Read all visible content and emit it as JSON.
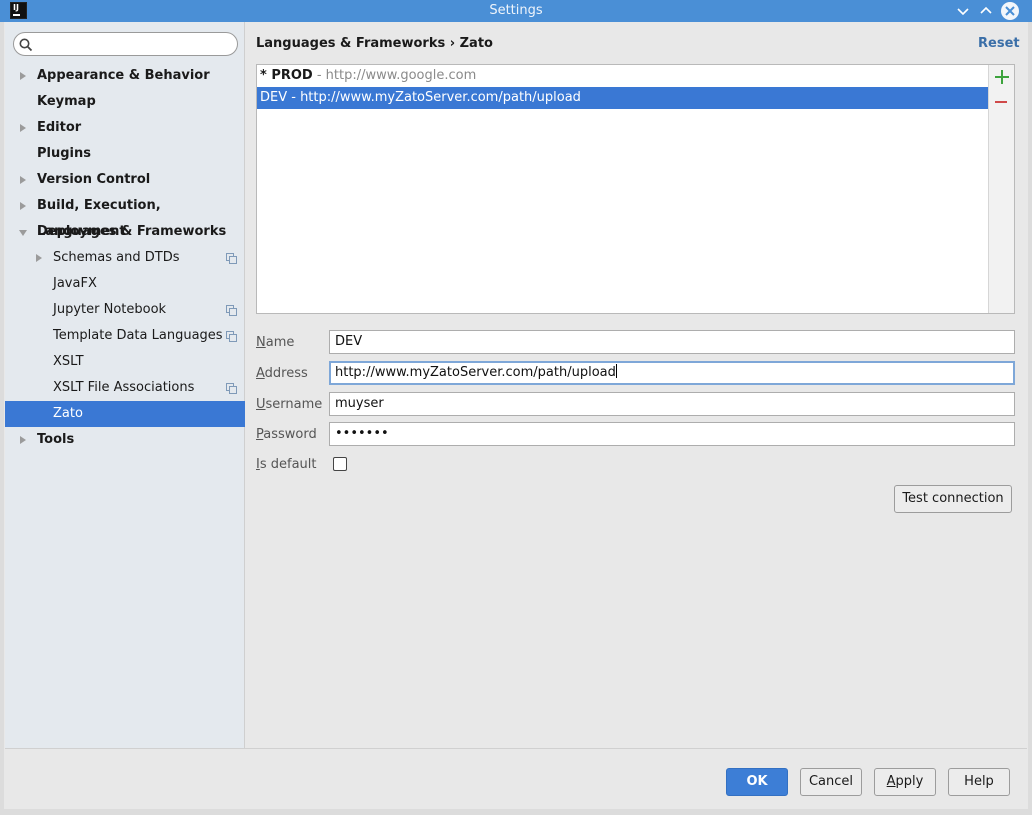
{
  "window": {
    "title": "Settings"
  },
  "search": {
    "placeholder": ""
  },
  "sidebar": {
    "items": [
      {
        "label": "Appearance & Behavior"
      },
      {
        "label": "Keymap"
      },
      {
        "label": "Editor"
      },
      {
        "label": "Plugins"
      },
      {
        "label": "Version Control"
      },
      {
        "label": "Build, Execution, Deployment"
      },
      {
        "label": "Languages & Frameworks"
      },
      {
        "label": "Schemas and DTDs"
      },
      {
        "label": "JavaFX"
      },
      {
        "label": "Jupyter Notebook"
      },
      {
        "label": "Template Data Languages"
      },
      {
        "label": "XSLT"
      },
      {
        "label": "XSLT File Associations"
      },
      {
        "label": "Zato"
      },
      {
        "label": "Tools"
      }
    ]
  },
  "header": {
    "breadcrumb": "Languages & Frameworks › Zato",
    "reset_label": "Reset"
  },
  "servers": {
    "rows": [
      {
        "prefix": "* PROD",
        "suffix": " - http://www.google.com"
      },
      {
        "text": "DEV - http://www.myZatoServer.com/path/upload"
      }
    ]
  },
  "form": {
    "name_label_u": "N",
    "name_label_rest": "ame",
    "name_value": "DEV",
    "address_label_u": "A",
    "address_label_rest": "ddress",
    "address_value": "http://www.myZatoServer.com/path/upload",
    "username_label_u": "U",
    "username_label_rest": "sername",
    "username_value": "muyser",
    "password_label_u": "P",
    "password_label_rest": "assword",
    "password_value": "•••••••",
    "default_label_u": "I",
    "default_label_rest": "s default",
    "test_connection_label": "Test connection"
  },
  "footer": {
    "ok_label": "OK",
    "cancel_label": "Cancel",
    "apply_label_u": "A",
    "apply_label_rest": "pply",
    "help_label": "Help"
  }
}
